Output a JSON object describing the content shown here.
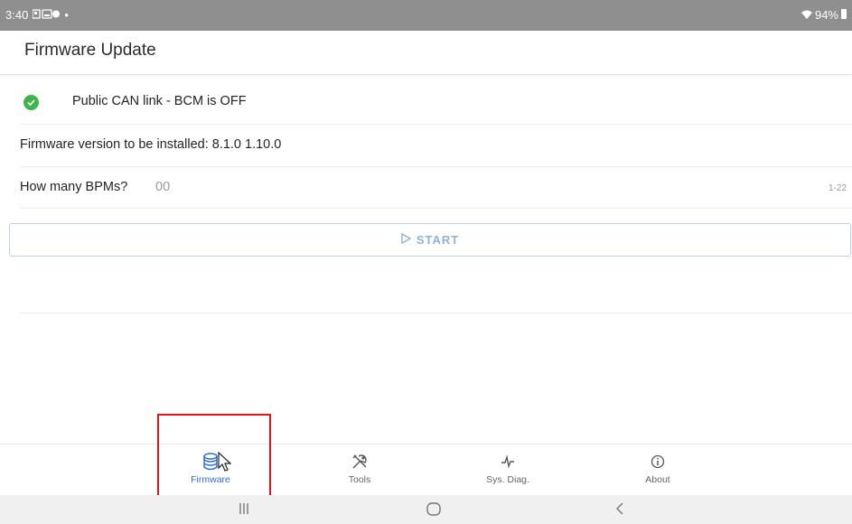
{
  "status_bar": {
    "time": "3:40",
    "battery": "94%"
  },
  "app_bar": {
    "title": "Firmware Update"
  },
  "can_status": {
    "text": "Public CAN link - BCM is OFF",
    "state_color": "#3db54a"
  },
  "firmware": {
    "text": "Firmware version to be installed: 8.1.0 1.10.0"
  },
  "bpm": {
    "label": "How many BPMs?",
    "value": "00",
    "range": "1-22"
  },
  "start_button": {
    "label": "START"
  },
  "bottom_nav": {
    "items": [
      {
        "label": "Firmware",
        "icon": "database-icon",
        "active": true
      },
      {
        "label": "Tools",
        "icon": "tools-icon",
        "active": false
      },
      {
        "label": "Sys. Diag.",
        "icon": "pulse-icon",
        "active": false
      },
      {
        "label": "About",
        "icon": "info-icon",
        "active": false
      }
    ]
  },
  "colors": {
    "accent": "#2f6fd6",
    "highlight": "#e0141b",
    "ok": "#3db54a",
    "statusbar": "#8f8f8f"
  }
}
